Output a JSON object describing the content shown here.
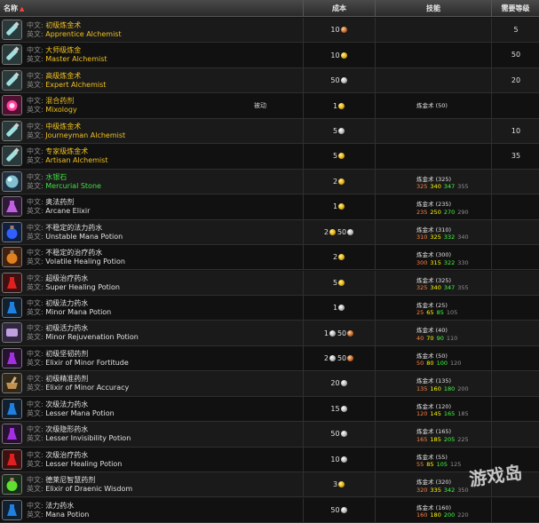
{
  "header": {
    "name": "名称",
    "cost": "成本",
    "skill": "技能",
    "req_level": "需要等级"
  },
  "labels": {
    "cn": "中文:",
    "en": "英文:"
  },
  "colors": {
    "gold_text": "#f0c020",
    "green_text": "#40e040",
    "orange": "#ff8040",
    "yellow": "#ffff00",
    "green": "#40ff40",
    "gray": "#909090"
  },
  "rows": [
    {
      "icon": "flask-icon",
      "cn": "初级炼金术",
      "en": "Apprentice Alchemist",
      "color": "gold",
      "passive": "",
      "cost": [
        {
          "n": "10",
          "c": "copper"
        }
      ],
      "skill": null,
      "req": "5"
    },
    {
      "icon": "flask-icon",
      "cn": "大师级炼金",
      "en": "Master Alchemist",
      "color": "gold",
      "passive": "",
      "cost": [
        {
          "n": "10",
          "c": "gold"
        }
      ],
      "skill": null,
      "req": "50"
    },
    {
      "icon": "flask-icon",
      "cn": "高级炼金术",
      "en": "Expert Alchemist",
      "color": "gold",
      "passive": "",
      "cost": [
        {
          "n": "50",
          "c": "silver"
        }
      ],
      "skill": null,
      "req": "20"
    },
    {
      "icon": "mixology-icon",
      "cn": "混合药剂",
      "en": "Mixology",
      "color": "gold",
      "passive": "被动",
      "cost": [
        {
          "n": "1",
          "c": "gold"
        }
      ],
      "skill": {
        "name": "炼金术 (50)",
        "levels": []
      },
      "req": ""
    },
    {
      "icon": "flask-icon",
      "cn": "中级炼金术",
      "en": "Journeyman Alchemist",
      "color": "gold",
      "passive": "",
      "cost": [
        {
          "n": "5",
          "c": "silver"
        }
      ],
      "skill": null,
      "req": "10"
    },
    {
      "icon": "flask-icon",
      "cn": "专家级炼金术",
      "en": "Artisan Alchemist",
      "color": "gold",
      "passive": "",
      "cost": [
        {
          "n": "5",
          "c": "gold"
        }
      ],
      "skill": null,
      "req": "35"
    },
    {
      "icon": "stone-icon",
      "cn": "水银石",
      "en": "Mercurial Stone",
      "color": "green",
      "passive": "",
      "cost": [
        {
          "n": "2",
          "c": "gold"
        }
      ],
      "skill": {
        "name": "炼金术 (325)",
        "levels": [
          "325",
          "340",
          "347",
          "355"
        ]
      },
      "req": ""
    },
    {
      "icon": "elixir-icon",
      "cn": "奥法药剂",
      "en": "Arcane Elixir",
      "color": "white",
      "passive": "",
      "cost": [
        {
          "n": "1",
          "c": "gold"
        }
      ],
      "skill": {
        "name": "炼金术 (235)",
        "levels": [
          "235",
          "250",
          "270",
          "290"
        ]
      },
      "req": ""
    },
    {
      "icon": "mana-potion-icon",
      "cn": "不稳定的法力药水",
      "en": "Unstable Mana Potion",
      "color": "white",
      "passive": "",
      "cost": [
        {
          "n": "2",
          "c": "gold"
        },
        {
          "n": "50",
          "c": "silver"
        }
      ],
      "skill": {
        "name": "炼金术 (310)",
        "levels": [
          "310",
          "325",
          "332",
          "340"
        ]
      },
      "req": ""
    },
    {
      "icon": "healing-potion-icon",
      "cn": "不稳定的治疗药水",
      "en": "Volatile Healing Potion",
      "color": "white",
      "passive": "",
      "cost": [
        {
          "n": "2",
          "c": "gold"
        }
      ],
      "skill": {
        "name": "炼金术 (300)",
        "levels": [
          "300",
          "315",
          "322",
          "330"
        ]
      },
      "req": ""
    },
    {
      "icon": "red-potion-icon",
      "cn": "超级治疗药水",
      "en": "Super Healing Potion",
      "color": "white",
      "passive": "",
      "cost": [
        {
          "n": "5",
          "c": "gold"
        }
      ],
      "skill": {
        "name": "炼金术 (325)",
        "levels": [
          "325",
          "340",
          "347",
          "355"
        ]
      },
      "req": ""
    },
    {
      "icon": "blue-potion-icon",
      "cn": "初级法力药水",
      "en": "Minor Mana Potion",
      "color": "white",
      "passive": "",
      "cost": [
        {
          "n": "1",
          "c": "silver"
        }
      ],
      "skill": {
        "name": "炼金术 (25)",
        "levels": [
          "25",
          "65",
          "85",
          "105"
        ]
      },
      "req": ""
    },
    {
      "icon": "scroll-icon",
      "cn": "初级活力药水",
      "en": "Minor Rejuvenation Potion",
      "color": "white",
      "passive": "",
      "cost": [
        {
          "n": "1",
          "c": "silver"
        },
        {
          "n": "50",
          "c": "copper"
        }
      ],
      "skill": {
        "name": "炼金术 (40)",
        "levels": [
          "40",
          "70",
          "90",
          "110"
        ]
      },
      "req": ""
    },
    {
      "icon": "purple-potion-icon",
      "cn": "初级坚韧药剂",
      "en": "Elixir of Minor Fortitude",
      "color": "white",
      "passive": "",
      "cost": [
        {
          "n": "2",
          "c": "silver"
        },
        {
          "n": "50",
          "c": "copper"
        }
      ],
      "skill": {
        "name": "炼金术 (50)",
        "levels": [
          "50",
          "80",
          "100",
          "120"
        ]
      },
      "req": ""
    },
    {
      "icon": "mortar-icon",
      "cn": "初级精准药剂",
      "en": "Elixir of Minor Accuracy",
      "color": "white",
      "passive": "",
      "cost": [
        {
          "n": "20",
          "c": "silver"
        }
      ],
      "skill": {
        "name": "炼金术 (135)",
        "levels": [
          "135",
          "160",
          "180",
          "200"
        ]
      },
      "req": ""
    },
    {
      "icon": "blue-potion-icon",
      "cn": "次级法力药水",
      "en": "Lesser Mana Potion",
      "color": "white",
      "passive": "",
      "cost": [
        {
          "n": "15",
          "c": "silver"
        }
      ],
      "skill": {
        "name": "炼金术 (120)",
        "levels": [
          "120",
          "145",
          "165",
          "185"
        ]
      },
      "req": ""
    },
    {
      "icon": "purple-potion-icon",
      "cn": "次级隐形药水",
      "en": "Lesser Invisibility Potion",
      "color": "white",
      "passive": "",
      "cost": [
        {
          "n": "50",
          "c": "silver"
        }
      ],
      "skill": {
        "name": "炼金术 (165)",
        "levels": [
          "165",
          "185",
          "205",
          "225"
        ]
      },
      "req": ""
    },
    {
      "icon": "red-potion-icon",
      "cn": "次级治疗药水",
      "en": "Lesser Healing Potion",
      "color": "white",
      "passive": "",
      "cost": [
        {
          "n": "10",
          "c": "silver"
        }
      ],
      "skill": {
        "name": "炼金术 (55)",
        "levels": [
          "55",
          "85",
          "105",
          "125"
        ]
      },
      "req": ""
    },
    {
      "icon": "green-potion-icon",
      "cn": "德莱尼智慧药剂",
      "en": "Elixir of Draenic Wisdom",
      "color": "white",
      "passive": "",
      "cost": [
        {
          "n": "3",
          "c": "gold"
        }
      ],
      "skill": {
        "name": "炼金术 (320)",
        "levels": [
          "320",
          "335",
          "342",
          "350"
        ]
      },
      "req": ""
    },
    {
      "icon": "blue-potion-icon",
      "cn": "法力药水",
      "en": "Mana Potion",
      "color": "white",
      "passive": "",
      "cost": [
        {
          "n": "50",
          "c": "silver"
        }
      ],
      "skill": {
        "name": "炼金术 (160)",
        "levels": [
          "160",
          "180",
          "200",
          "220"
        ]
      },
      "req": ""
    }
  ],
  "watermark": "游戏岛"
}
